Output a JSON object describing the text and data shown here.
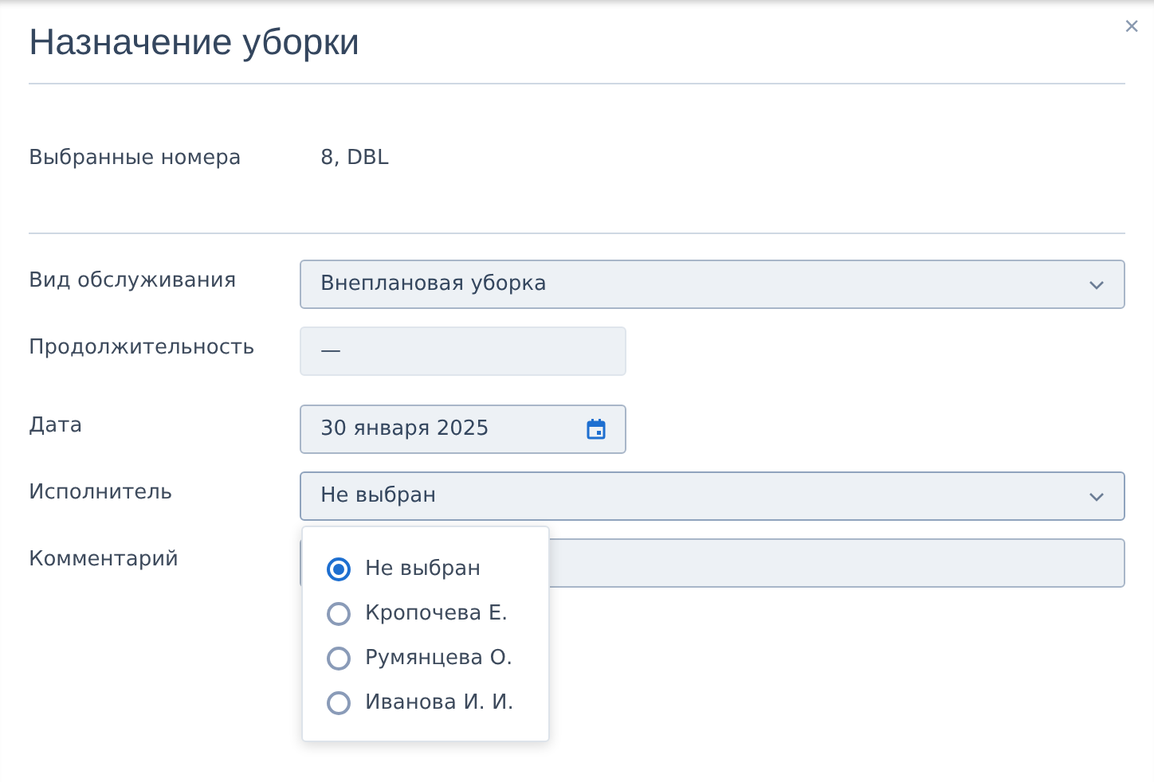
{
  "dialog": {
    "title": "Назначение уборки",
    "close": "×"
  },
  "summary": {
    "label": "Выбранные номера",
    "value": "8, DBL"
  },
  "fields": [
    {
      "kind": "select",
      "label": "Вид обслуживания",
      "value": "Внеплановая уборка"
    },
    {
      "kind": "readonly",
      "label": "Продолжительность",
      "value": "—"
    },
    {
      "kind": "date",
      "label": "Дата",
      "value": "30 января 2025"
    },
    {
      "kind": "select",
      "label": "Исполнитель",
      "value": "Не выбран",
      "expanded": true
    },
    {
      "kind": "text",
      "label": "Комментарий"
    }
  ],
  "dropdown_options": [
    {
      "label": "Не выбран",
      "selected": true
    },
    {
      "label": "Кропочева Е.",
      "selected": false
    },
    {
      "label": "Румянцева О.",
      "selected": false
    },
    {
      "label": "Иванова И. И.",
      "selected": false
    }
  ]
}
